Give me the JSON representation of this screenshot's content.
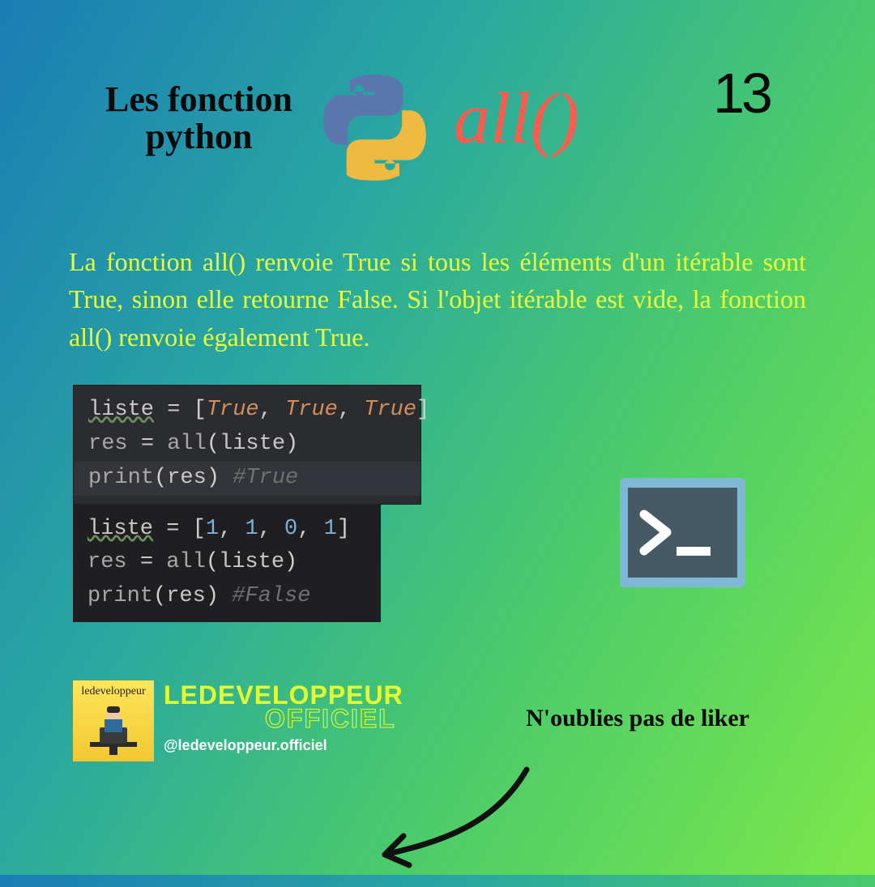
{
  "header": {
    "title_line1": "Les fonction",
    "title_line2": "python",
    "function_name": "all()",
    "page_number": "13"
  },
  "description": "La fonction all() renvoie True si tous les éléments d'un itérable sont True, sinon elle retourne False. Si l'objet itérable est vide, la fonction all() renvoie également True.",
  "code_examples": [
    {
      "lines": [
        "liste = [True, True, True]",
        "res = all(liste)",
        "print(res) #True"
      ],
      "output_comment": "#True"
    },
    {
      "lines": [
        "liste = [1, 1, 0, 1]",
        "res = all(liste)",
        "print(res) #False"
      ],
      "output_comment": "#False"
    }
  ],
  "footer": {
    "avatar_caption": "ledeveloppeur",
    "brand_main": "LEDEVELOPPEUR",
    "brand_sub": "OFFICIEL",
    "handle": "@ledeveloppeur.officiel",
    "cta": "N'oublies pas de liker"
  },
  "icons": {
    "python": "python-logo",
    "terminal": "terminal-icon",
    "arrow": "curved-arrow-icon",
    "avatar": "developer-avatar-icon"
  }
}
